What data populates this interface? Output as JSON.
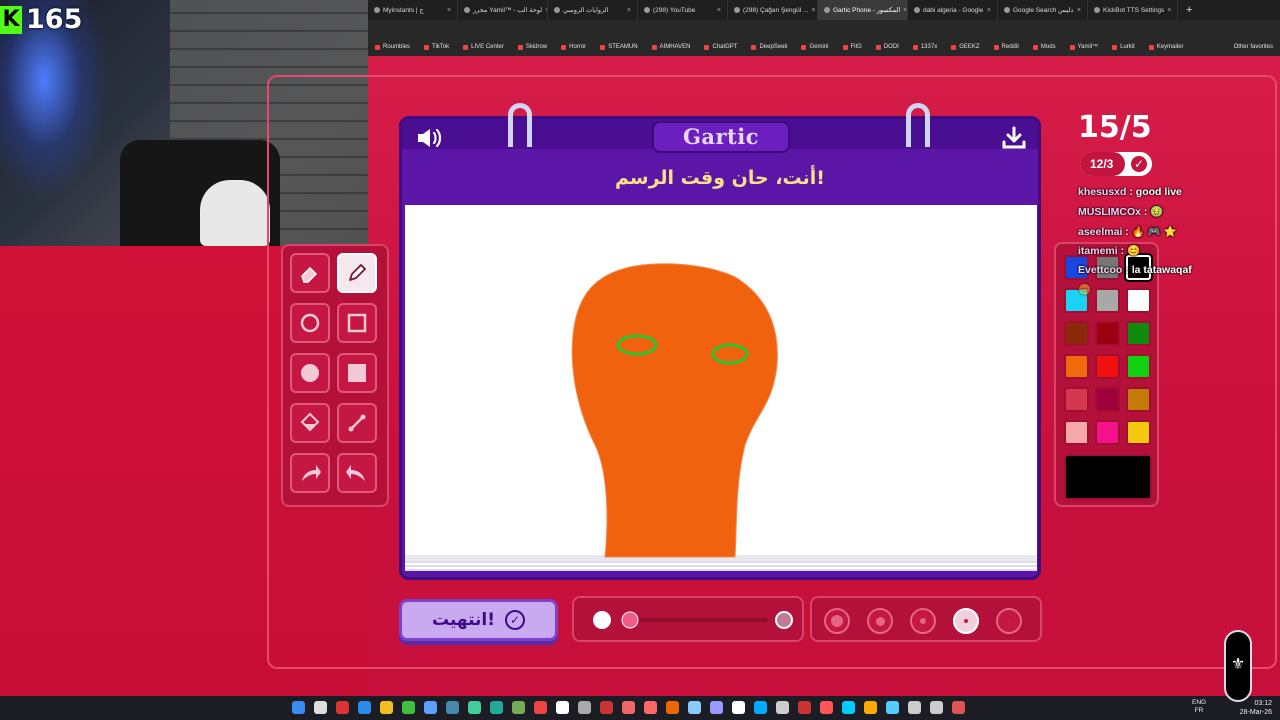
{
  "stream": {
    "viewer_count": "165"
  },
  "browser": {
    "tabs": [
      {
        "label": "Myinstants | ج",
        "active": false
      },
      {
        "label": "محرر Yamil™ - لوحة الب",
        "active": false
      },
      {
        "label": "الروايات الروسي",
        "active": false
      },
      {
        "label": "(298) YouTube",
        "active": false
      },
      {
        "label": "(298) Çağan Şengül ...",
        "active": false
      },
      {
        "label": "Gartic Phone - المكسور",
        "active": true
      },
      {
        "label": "dabi algeria - Google",
        "active": false
      },
      {
        "label": "Google Search دليس",
        "active": false
      },
      {
        "label": "KickBot TTS Settings",
        "active": false
      }
    ],
    "bookmarks": [
      "Roumbles",
      "TikTok",
      "LIVE Center",
      "Skidrow",
      "Horror",
      "STEAMUN",
      "AIMHAVEN",
      "ChatGPT",
      "DeepSeek",
      "Gemini",
      "FitG",
      "DODI",
      "1337x",
      "GEEKZ",
      "Reddit",
      "Mods",
      "Yamil™",
      "Lurkit",
      "Keymailer"
    ],
    "other_favorites": "Other favorites"
  },
  "game": {
    "logo": "Gartic",
    "prompt": "أنت، حان وقت الرسم!",
    "round": "15/5",
    "timer": "12/3",
    "timer_fill_fraction": 0.62,
    "done_label": "انتهيت!",
    "selected_color": "#000000",
    "brush_opacity_fraction": 0.0,
    "selected_size_index": 3
  },
  "tools": [
    {
      "name": "eraser-tool",
      "icon": "eraser-icon",
      "active": false
    },
    {
      "name": "pencil-tool",
      "icon": "pencil-icon",
      "active": true
    },
    {
      "name": "ellipse-outline-tool",
      "icon": "circle-outline-icon",
      "active": false
    },
    {
      "name": "rectangle-outline-tool",
      "icon": "square-outline-icon",
      "active": false
    },
    {
      "name": "ellipse-fill-tool",
      "icon": "circle-fill-icon",
      "active": false
    },
    {
      "name": "rectangle-fill-tool",
      "icon": "square-fill-icon",
      "active": false
    },
    {
      "name": "fill-bucket-tool",
      "icon": "bucket-icon",
      "active": false
    },
    {
      "name": "line-tool",
      "icon": "line-icon",
      "active": false
    },
    {
      "name": "undo-tool",
      "icon": "undo-icon",
      "active": false
    },
    {
      "name": "redo-tool",
      "icon": "redo-icon",
      "active": false
    }
  ],
  "palette": [
    "#1846e0",
    "#777777",
    "#000000",
    "#19d3f5",
    "#a8a8a8",
    "#ffffff",
    "#8a2a08",
    "#9c0010",
    "#0f8a0f",
    "#f06a0c",
    "#f01010",
    "#10d010",
    "#d4364e",
    "#a0003c",
    "#c47a08",
    "#f5a8a8",
    "#f5108c",
    "#f5c810"
  ],
  "chat": [
    {
      "user": "",
      "msg": "",
      "faded": true
    },
    {
      "user": "khesusxd",
      "msg": "good live",
      "faded": false
    },
    {
      "user": "MUSLIMCOx",
      "msg": "🤢",
      "faded": false
    },
    {
      "user": "aseelmai",
      "msg": "🔥 🎮 ⭐",
      "faded": false
    },
    {
      "user": "itamemi",
      "msg": "😊",
      "faded": false
    },
    {
      "user": "Evettcoo",
      "msg": "la tatawaqaf",
      "faded": false
    },
    {
      "user": "",
      "msg": "😊",
      "faded": true
    }
  ],
  "taskbar": {
    "lang_top": "ENG",
    "lang_bottom": "FR",
    "time": "03:12",
    "date": "28-Mar-26"
  }
}
